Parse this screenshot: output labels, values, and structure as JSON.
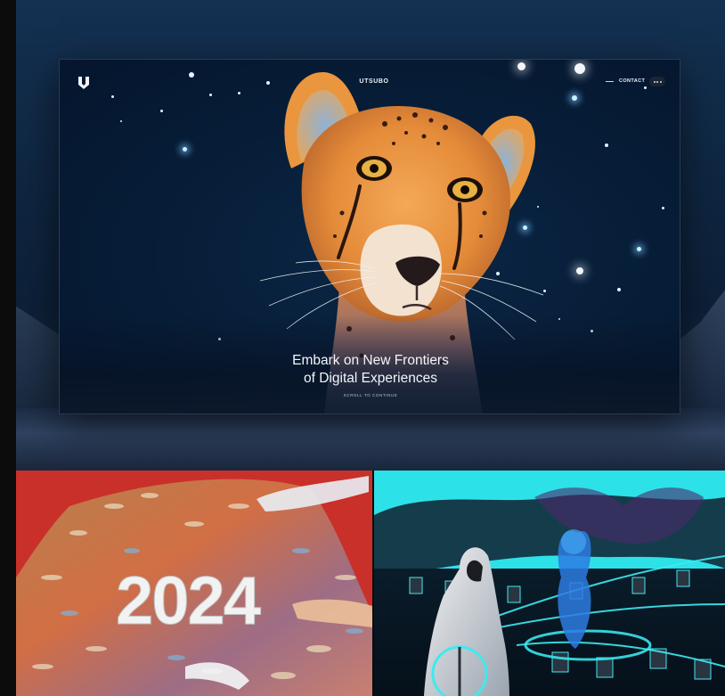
{
  "site": {
    "brand": "UTSUBO",
    "nav": {
      "contact_label": "CONTACT",
      "menu_icon": "ellipsis-icon"
    },
    "hero": {
      "headline_line1": "Embark on New Frontiers",
      "headline_line2": "of Digital Experiences",
      "scroll_hint": "SCROLL TO CONTINUE"
    }
  },
  "colors": {
    "backdrop": "#0f2742",
    "hero_background": "#071d37",
    "cheetah_fur": "#e9913f",
    "thumb_red": "#c9302a",
    "thumb_cyan": "#2de1e8"
  },
  "thumbnails": [
    {
      "name": "koi-2024",
      "text": "2024",
      "background": "#c9302a"
    },
    {
      "name": "hooded-figure",
      "text": "",
      "background": "#2de1e8"
    }
  ]
}
